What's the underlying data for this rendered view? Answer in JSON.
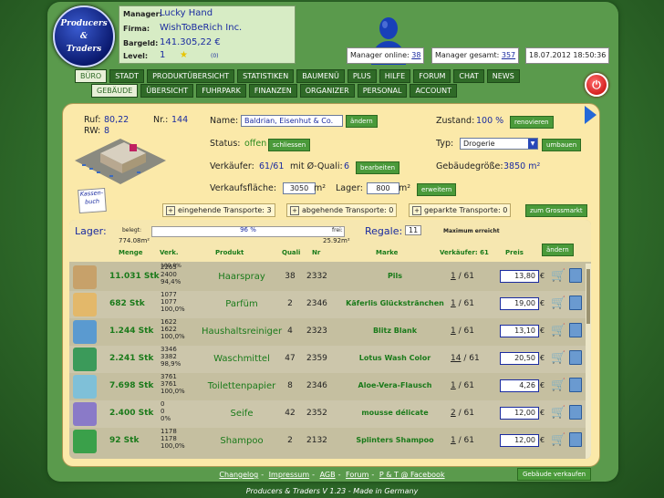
{
  "logo": {
    "line1": "Producers",
    "line2": "&",
    "line3": "Traders"
  },
  "info": {
    "manager_label": "Manager:",
    "manager": "Lucky Hand",
    "firma_label": "Firma:",
    "firma": "WishToBeRich Inc.",
    "bargeld_label": "Bargeld:",
    "bargeld": "141.305,22 €",
    "level_label": "Level:",
    "level": "1",
    "level_extra": "(0)"
  },
  "top": {
    "online_label": "Manager online:",
    "online": "38",
    "gesamt_label": "Manager gesamt:",
    "gesamt": "357",
    "datetime": "18.07.2012 18:50:36"
  },
  "nav1": [
    "BÜRO",
    "STADT",
    "PRODUKTÜBERSICHT",
    "STATISTIKEN",
    "BAUMENÜ",
    "PLUS",
    "HILFE",
    "FORUM",
    "CHAT",
    "NEWS"
  ],
  "nav2": [
    "GEBÄUDE",
    "ÜBERSICHT",
    "FUHRPARK",
    "FINANZEN",
    "ORGANIZER",
    "PERSONAL",
    "ACCOUNT"
  ],
  "building": {
    "ruf_label": "Ruf:",
    "ruf": "80,22",
    "rw_label": "RW:",
    "rw": "8",
    "nr_label": "Nr.:",
    "nr": "144",
    "kassenbuch": "Kassen-buch",
    "name_label": "Name:",
    "name": "Baldrian, Eisenhut & Co.",
    "name_btn": "ändern",
    "zustand_label": "Zustand:",
    "zustand": "100 %",
    "zustand_btn": "renovieren",
    "status_label": "Status:",
    "status": "offen",
    "status_btn": "schliessen",
    "typ_label": "Typ:",
    "typ": "Drogerie",
    "typ_btn": "umbauen",
    "verk_label": "Verkäufer:",
    "verk": "61/61",
    "verk_quali_label": "mit Ø-Quali:",
    "verk_quali": "6",
    "verk_btn": "bearbeiten",
    "groesse_label": "Gebäudegröße:",
    "groesse": "3850 m²",
    "flaeche_label": "Verkaufsfläche:",
    "flaeche": "3050",
    "flaeche_unit": "m²",
    "lager_label": "Lager:",
    "lager": "800",
    "lager_unit": "m²",
    "lager_btn": "erweitern"
  },
  "transports": {
    "eingehende": "eingehende Transporte: 3",
    "abgehende": "abgehende Transporte: 0",
    "geparkte": "geparkte Transporte: 0",
    "grossmarkt": "zum Grossmarkt"
  },
  "warehouse": {
    "title": "Lager:",
    "belegt_label": "belegt:",
    "belegt": "774.08m²",
    "percent": "96 %",
    "fill": 0.96,
    "frei_label": "frei:",
    "frei": "25.92m²",
    "regale_label": "Regale:",
    "regale": "11",
    "max": "Maximum erreicht",
    "aendern": "ändern",
    "cols": {
      "menge": "Menge",
      "verk": "Verk.",
      "produkt": "Produkt",
      "quali": "Quali",
      "nr": "Nr",
      "marke": "Marke",
      "verkaeufer": "Verkäufer: 61",
      "preis": "Preis"
    },
    "top_partial": "100,0%",
    "rows": [
      {
        "vk": [
          "2265",
          "2400",
          "94,4%"
        ],
        "menge": "11.031 Stk",
        "produkt": "Haarspray",
        "quali": "38",
        "nr": "2332",
        "marke": "Pils",
        "verk_n": "1",
        "verk_d": "/ 61",
        "preis": "13,80",
        "img": "#c7a16a"
      },
      {
        "vk": [
          "1077",
          "1077",
          "100,0%"
        ],
        "menge": "682 Stk",
        "produkt": "Parfüm",
        "quali": "2",
        "nr": "2346",
        "marke": "Käferlis Glückstränchen",
        "verk_n": "1",
        "verk_d": "/ 61",
        "preis": "19,00",
        "img": "#e3b86a"
      },
      {
        "vk": [
          "1622",
          "1622",
          "100,0%"
        ],
        "menge": "1.244 Stk",
        "produkt": "Haushaltsreiniger",
        "quali": "4",
        "nr": "2323",
        "marke": "Blitz Blank",
        "verk_n": "1",
        "verk_d": "/ 61",
        "preis": "13,10",
        "img": "#5a9ad0"
      },
      {
        "vk": [
          "3346",
          "3382",
          "98,9%"
        ],
        "menge": "2.241 Stk",
        "produkt": "Waschmittel",
        "quali": "47",
        "nr": "2359",
        "marke": "Lotus Wash Color",
        "verk_n": "14",
        "verk_d": "/ 61",
        "preis": "20,50",
        "img": "#3b9a5a"
      },
      {
        "vk": [
          "3761",
          "3761",
          "100,0%"
        ],
        "menge": "7.698 Stk",
        "produkt": "Toilettenpapier",
        "quali": "8",
        "nr": "2346",
        "marke": "Aloe-Vera-Flausch",
        "verk_n": "1",
        "verk_d": "/ 61",
        "preis": "4,26",
        "img": "#7fc0d8"
      },
      {
        "vk": [
          "0",
          "0",
          "0%"
        ],
        "menge": "2.400 Stk",
        "produkt": "Seife",
        "quali": "42",
        "nr": "2352",
        "marke": "mousse délicate",
        "verk_n": "2",
        "verk_d": "/ 61",
        "preis": "12,00",
        "img": "#8a7ac8"
      },
      {
        "vk": [
          "1178",
          "1178",
          "100,0%"
        ],
        "menge": "92 Stk",
        "produkt": "Shampoo",
        "quali": "2",
        "nr": "2132",
        "marke": "Splinters Shampoo",
        "verk_n": "1",
        "verk_d": "/ 61",
        "preis": "12,00",
        "img": "#3aa04a"
      }
    ],
    "currency": "€"
  },
  "footer": {
    "links": [
      "Changelog",
      "Impressum",
      "AGB",
      "Forum",
      "P & T @ Facebook"
    ],
    "sep": "-",
    "version": "Producers & Traders V 1.23 - Made in Germany",
    "sell_btn": "Gebäude verkaufen"
  }
}
